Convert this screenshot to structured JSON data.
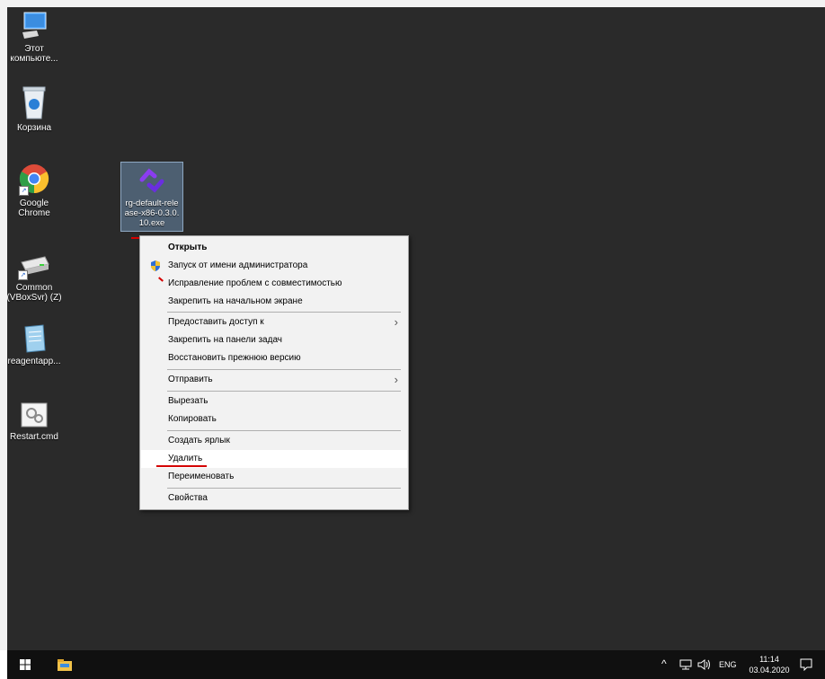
{
  "desktop": {
    "icons": [
      {
        "label": "Этот компьюте...",
        "icon": "this-pc-icon"
      },
      {
        "label": "Корзина",
        "icon": "recycle-bin-icon"
      },
      {
        "label": "Google Chrome",
        "icon": "chrome-icon"
      },
      {
        "label": "rg-default-release-x86-0.3.0.10.exe",
        "icon": "rg-exe-icon"
      },
      {
        "label": "Common (VBoxSvr) (Z)",
        "icon": "network-drive-icon"
      },
      {
        "label": "reagentapp...",
        "icon": "notepad-file-icon"
      },
      {
        "label": "Restart.cmd",
        "icon": "cmd-file-icon"
      }
    ]
  },
  "context_menu": {
    "items": [
      "Открыть",
      "Запуск от имени администратора",
      "Исправление проблем с совместимостью",
      "Закрепить на начальном экране",
      "Предоставить доступ к",
      "Закрепить на панели задач",
      "Восстановить прежнюю версию",
      "Отправить",
      "Вырезать",
      "Копировать",
      "Создать ярлык",
      "Удалить",
      "Переименовать",
      "Свойства"
    ]
  },
  "taskbar": {
    "tray_chevron": "^",
    "language": "ENG",
    "time": "11:14",
    "date": "03.04.2020"
  },
  "colors": {
    "desktop_bg": "#2a2a2a",
    "menu_bg": "#f2f2f2",
    "menu_highlight": "#ffffff",
    "annotation_red": "#d40000",
    "taskbar_bg": "#101010"
  }
}
